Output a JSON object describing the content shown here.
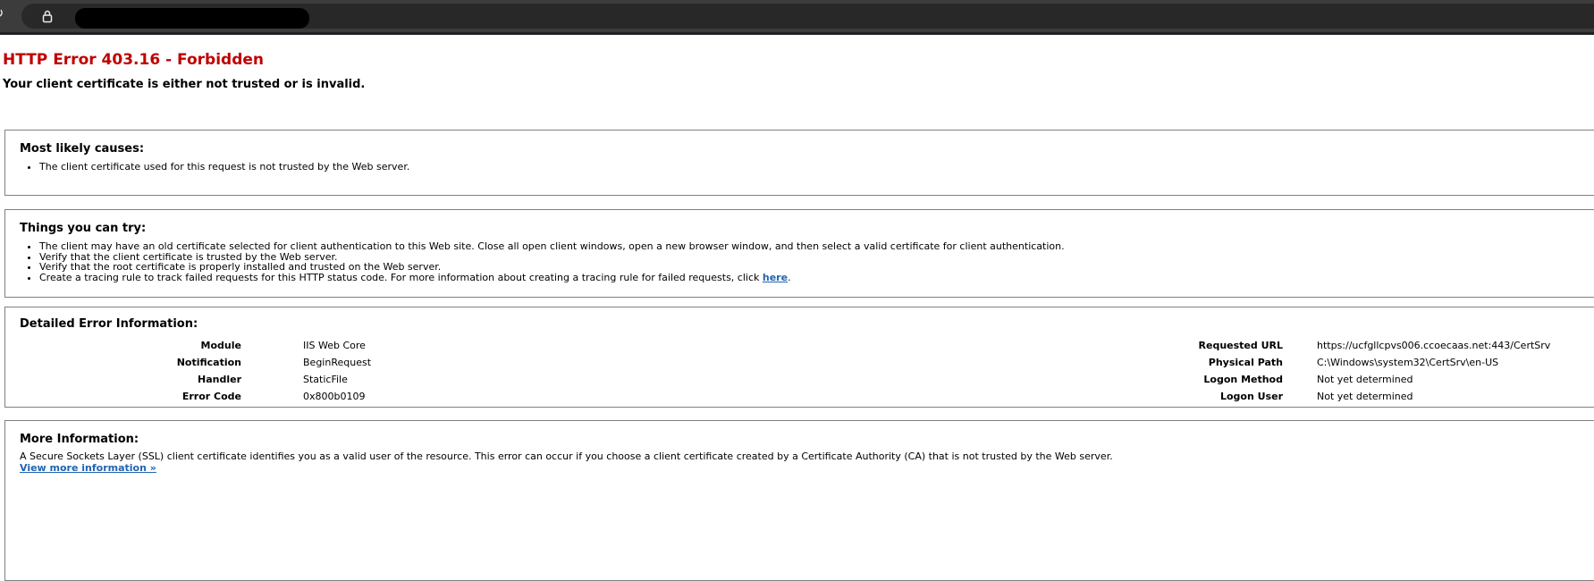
{
  "page": {
    "title": "HTTP Error 403.16 - Forbidden",
    "subtitle": "Your client certificate is either not trusted or is invalid."
  },
  "browser": {
    "reload_icon": "reload-icon",
    "lock_icon": "lock-icon"
  },
  "causes": {
    "heading": "Most likely causes:",
    "items": [
      "The client certificate used for this request is not trusted by the Web server."
    ]
  },
  "try": {
    "heading": "Things you can try:",
    "items": [
      "The client may have an old certificate selected for client authentication to this Web site. Close all open client windows, open a new browser window, and then select a valid certificate for client authentication.",
      "Verify that the client certificate is trusted by the Web server.",
      "Verify that the root certificate is properly installed and trusted on the Web server."
    ],
    "tracing_text": "Create a tracing rule to track failed requests for this HTTP status code. For more information about creating a tracing rule for failed requests, click ",
    "tracing_link": "here",
    "tracing_end": "."
  },
  "details": {
    "heading": "Detailed Error Information:",
    "left": [
      {
        "label": "Module",
        "value": "IIS Web Core"
      },
      {
        "label": "Notification",
        "value": "BeginRequest"
      },
      {
        "label": "Handler",
        "value": "StaticFile"
      },
      {
        "label": "Error Code",
        "value": "0x800b0109"
      }
    ],
    "right": [
      {
        "label": "Requested URL",
        "value": "https://ucfgllcpvs006.ccoecaas.net:443/CertSrv"
      },
      {
        "label": "Physical Path",
        "value": "C:\\Windows\\system32\\CertSrv\\en-US"
      },
      {
        "label": "Logon Method",
        "value": "Not yet determined"
      },
      {
        "label": "Logon User",
        "value": "Not yet determined"
      }
    ]
  },
  "more": {
    "heading": "More Information:",
    "text": "A Secure Sockets Layer (SSL) client certificate identifies you as a valid user of the resource. This error can occur if you choose a client certificate created by a Certificate Authority (CA) that is not trusted by the Web server.",
    "link": "View more information »"
  },
  "colors": {
    "title": "#c00000",
    "link": "#2264b0",
    "border": "#808080"
  }
}
